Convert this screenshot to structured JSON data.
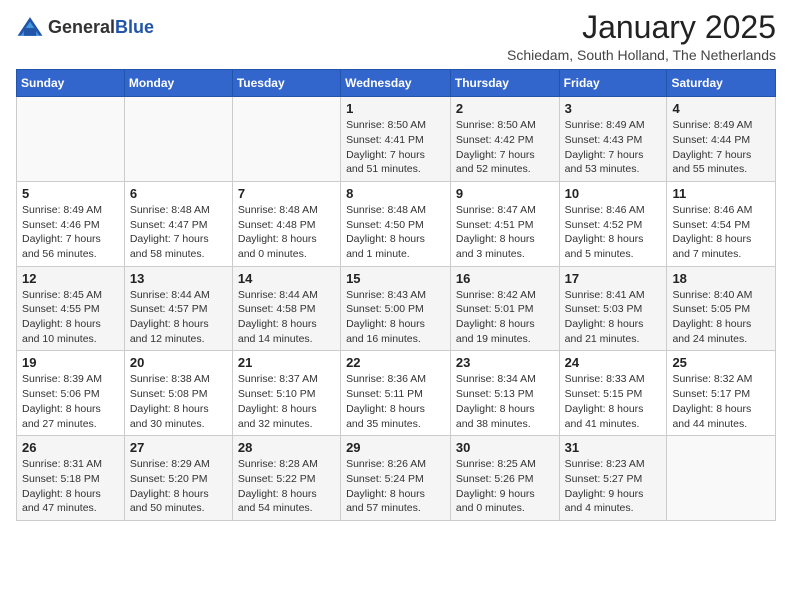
{
  "header": {
    "logo_general": "General",
    "logo_blue": "Blue",
    "month_title": "January 2025",
    "subtitle": "Schiedam, South Holland, The Netherlands"
  },
  "days_of_week": [
    "Sunday",
    "Monday",
    "Tuesday",
    "Wednesday",
    "Thursday",
    "Friday",
    "Saturday"
  ],
  "weeks": [
    [
      {
        "day": "",
        "info": ""
      },
      {
        "day": "",
        "info": ""
      },
      {
        "day": "",
        "info": ""
      },
      {
        "day": "1",
        "info": "Sunrise: 8:50 AM\nSunset: 4:41 PM\nDaylight: 7 hours\nand 51 minutes."
      },
      {
        "day": "2",
        "info": "Sunrise: 8:50 AM\nSunset: 4:42 PM\nDaylight: 7 hours\nand 52 minutes."
      },
      {
        "day": "3",
        "info": "Sunrise: 8:49 AM\nSunset: 4:43 PM\nDaylight: 7 hours\nand 53 minutes."
      },
      {
        "day": "4",
        "info": "Sunrise: 8:49 AM\nSunset: 4:44 PM\nDaylight: 7 hours\nand 55 minutes."
      }
    ],
    [
      {
        "day": "5",
        "info": "Sunrise: 8:49 AM\nSunset: 4:46 PM\nDaylight: 7 hours\nand 56 minutes."
      },
      {
        "day": "6",
        "info": "Sunrise: 8:48 AM\nSunset: 4:47 PM\nDaylight: 7 hours\nand 58 minutes."
      },
      {
        "day": "7",
        "info": "Sunrise: 8:48 AM\nSunset: 4:48 PM\nDaylight: 8 hours\nand 0 minutes."
      },
      {
        "day": "8",
        "info": "Sunrise: 8:48 AM\nSunset: 4:50 PM\nDaylight: 8 hours\nand 1 minute."
      },
      {
        "day": "9",
        "info": "Sunrise: 8:47 AM\nSunset: 4:51 PM\nDaylight: 8 hours\nand 3 minutes."
      },
      {
        "day": "10",
        "info": "Sunrise: 8:46 AM\nSunset: 4:52 PM\nDaylight: 8 hours\nand 5 minutes."
      },
      {
        "day": "11",
        "info": "Sunrise: 8:46 AM\nSunset: 4:54 PM\nDaylight: 8 hours\nand 7 minutes."
      }
    ],
    [
      {
        "day": "12",
        "info": "Sunrise: 8:45 AM\nSunset: 4:55 PM\nDaylight: 8 hours\nand 10 minutes."
      },
      {
        "day": "13",
        "info": "Sunrise: 8:44 AM\nSunset: 4:57 PM\nDaylight: 8 hours\nand 12 minutes."
      },
      {
        "day": "14",
        "info": "Sunrise: 8:44 AM\nSunset: 4:58 PM\nDaylight: 8 hours\nand 14 minutes."
      },
      {
        "day": "15",
        "info": "Sunrise: 8:43 AM\nSunset: 5:00 PM\nDaylight: 8 hours\nand 16 minutes."
      },
      {
        "day": "16",
        "info": "Sunrise: 8:42 AM\nSunset: 5:01 PM\nDaylight: 8 hours\nand 19 minutes."
      },
      {
        "day": "17",
        "info": "Sunrise: 8:41 AM\nSunset: 5:03 PM\nDaylight: 8 hours\nand 21 minutes."
      },
      {
        "day": "18",
        "info": "Sunrise: 8:40 AM\nSunset: 5:05 PM\nDaylight: 8 hours\nand 24 minutes."
      }
    ],
    [
      {
        "day": "19",
        "info": "Sunrise: 8:39 AM\nSunset: 5:06 PM\nDaylight: 8 hours\nand 27 minutes."
      },
      {
        "day": "20",
        "info": "Sunrise: 8:38 AM\nSunset: 5:08 PM\nDaylight: 8 hours\nand 30 minutes."
      },
      {
        "day": "21",
        "info": "Sunrise: 8:37 AM\nSunset: 5:10 PM\nDaylight: 8 hours\nand 32 minutes."
      },
      {
        "day": "22",
        "info": "Sunrise: 8:36 AM\nSunset: 5:11 PM\nDaylight: 8 hours\nand 35 minutes."
      },
      {
        "day": "23",
        "info": "Sunrise: 8:34 AM\nSunset: 5:13 PM\nDaylight: 8 hours\nand 38 minutes."
      },
      {
        "day": "24",
        "info": "Sunrise: 8:33 AM\nSunset: 5:15 PM\nDaylight: 8 hours\nand 41 minutes."
      },
      {
        "day": "25",
        "info": "Sunrise: 8:32 AM\nSunset: 5:17 PM\nDaylight: 8 hours\nand 44 minutes."
      }
    ],
    [
      {
        "day": "26",
        "info": "Sunrise: 8:31 AM\nSunset: 5:18 PM\nDaylight: 8 hours\nand 47 minutes."
      },
      {
        "day": "27",
        "info": "Sunrise: 8:29 AM\nSunset: 5:20 PM\nDaylight: 8 hours\nand 50 minutes."
      },
      {
        "day": "28",
        "info": "Sunrise: 8:28 AM\nSunset: 5:22 PM\nDaylight: 8 hours\nand 54 minutes."
      },
      {
        "day": "29",
        "info": "Sunrise: 8:26 AM\nSunset: 5:24 PM\nDaylight: 8 hours\nand 57 minutes."
      },
      {
        "day": "30",
        "info": "Sunrise: 8:25 AM\nSunset: 5:26 PM\nDaylight: 9 hours\nand 0 minutes."
      },
      {
        "day": "31",
        "info": "Sunrise: 8:23 AM\nSunset: 5:27 PM\nDaylight: 9 hours\nand 4 minutes."
      },
      {
        "day": "",
        "info": ""
      }
    ]
  ]
}
